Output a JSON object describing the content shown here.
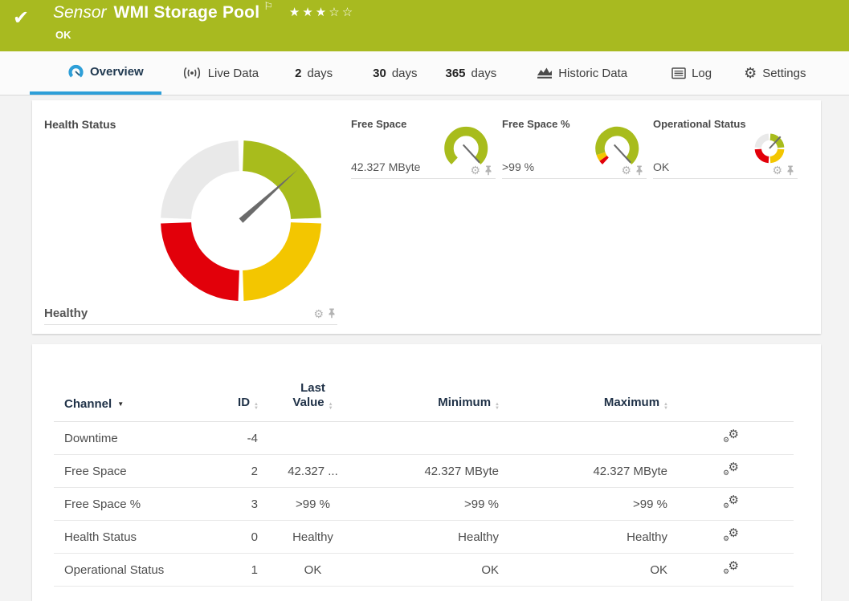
{
  "header": {
    "type_label": "Sensor",
    "title": "WMI Storage Pool",
    "status": "OK",
    "stars": "★★★☆☆"
  },
  "tabs": [
    {
      "label": "Overview",
      "active": true,
      "icon": "gauge-icon"
    },
    {
      "label": "Live Data",
      "icon": "broadcast-icon"
    },
    {
      "number": "2",
      "label": "days"
    },
    {
      "number": "30",
      "label": "days"
    },
    {
      "number": "365",
      "label": "days"
    },
    {
      "label": "Historic Data",
      "icon": "area-chart-icon"
    },
    {
      "label": "Log",
      "icon": "list-icon"
    },
    {
      "label": "Settings",
      "icon": "gear-icon"
    }
  ],
  "overview": {
    "health": {
      "title": "Health Status",
      "value": "Healthy",
      "gauge": {
        "type": "quadrant-donut",
        "segments": [
          "gray",
          "green",
          "yellow",
          "red"
        ],
        "needle": "upper-right"
      }
    },
    "gauges": [
      {
        "title": "Free Space",
        "value": "42.327 MByte",
        "gauge": {
          "type": "arc",
          "segments": [
            "green"
          ],
          "needle": "lower-right"
        }
      },
      {
        "title": "Free Space %",
        "value": ">99 %",
        "gauge": {
          "type": "arc",
          "segments": [
            "red",
            "yellow",
            "green"
          ],
          "needle": "lower-right"
        }
      },
      {
        "title": "Operational Status",
        "value": "OK",
        "gauge": {
          "type": "quadrant-donut",
          "segments": [
            "gray",
            "green",
            "yellow",
            "red"
          ],
          "needle": "upper-right"
        }
      }
    ]
  },
  "table": {
    "columns": [
      "Channel",
      "ID",
      "Last Value",
      "Minimum",
      "Maximum"
    ],
    "rows": [
      {
        "channel": "Downtime",
        "id": "-4",
        "last": "",
        "min": "",
        "max": ""
      },
      {
        "channel": "Free Space",
        "id": "2",
        "last": "42.327 ...",
        "min": "42.327 MByte",
        "max": "42.327 MByte"
      },
      {
        "channel": "Free Space %",
        "id": "3",
        "last": ">99 %",
        "min": ">99 %",
        "max": ">99 %"
      },
      {
        "channel": "Health Status",
        "id": "0",
        "last": "Healthy",
        "min": "Healthy",
        "max": "Healthy"
      },
      {
        "channel": "Operational Status",
        "id": "1",
        "last": "OK",
        "min": "OK",
        "max": "OK"
      }
    ]
  },
  "colors": {
    "brand_green": "#a8ba20",
    "gauge_green": "#a8bc1c",
    "gauge_yellow": "#f3c600",
    "gauge_red": "#e2000a",
    "gauge_gray": "#e9e9e9",
    "accent_blue": "#2e9fd8"
  }
}
